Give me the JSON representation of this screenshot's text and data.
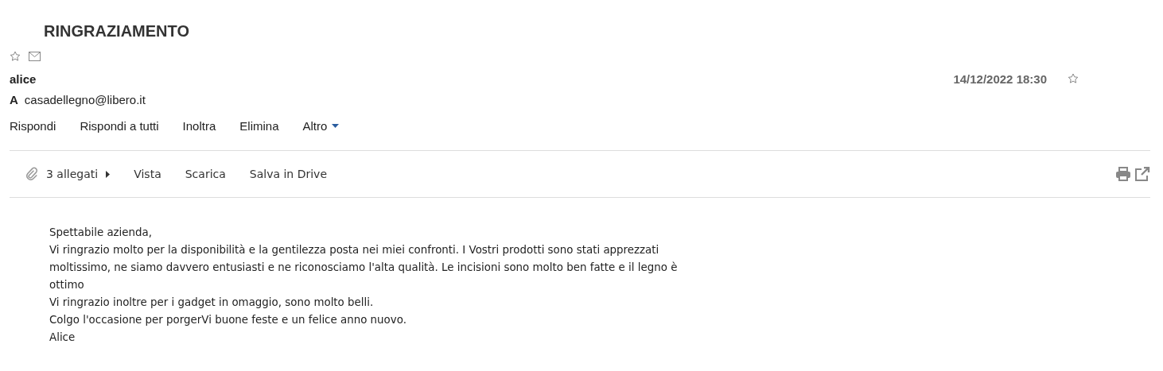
{
  "subject": "RINGRAZIAMENTO",
  "sender": "alice",
  "date": "14/12/2022 18:30",
  "to_label": "A",
  "to": "casadellegno@libero.it",
  "actions": [
    "Rispondi",
    "Rispondi a tutti",
    "Inoltra",
    "Elimina",
    "Altro"
  ],
  "attachments": {
    "count": "3 allegati",
    "actions": [
      "Vista",
      "Scarica",
      "Salva in Drive"
    ]
  },
  "body_lines": [
    "Spettabile azienda,",
    "Vi ringrazio molto per la disponibilità e la gentilezza posta nei miei confronti. I Vostri prodotti sono stati apprezzati",
    "moltissimo, ne siamo davvero entusiasti e ne riconosciamo l'alta qualità. Le incisioni sono molto ben fatte e il legno è",
    "ottimo",
    "Vi ringrazio inoltre per i gadget in omaggio, sono molto belli.",
    "Colgo l'occasione per porgerVi buone feste e un felice anno nuovo.",
    "Alice"
  ]
}
